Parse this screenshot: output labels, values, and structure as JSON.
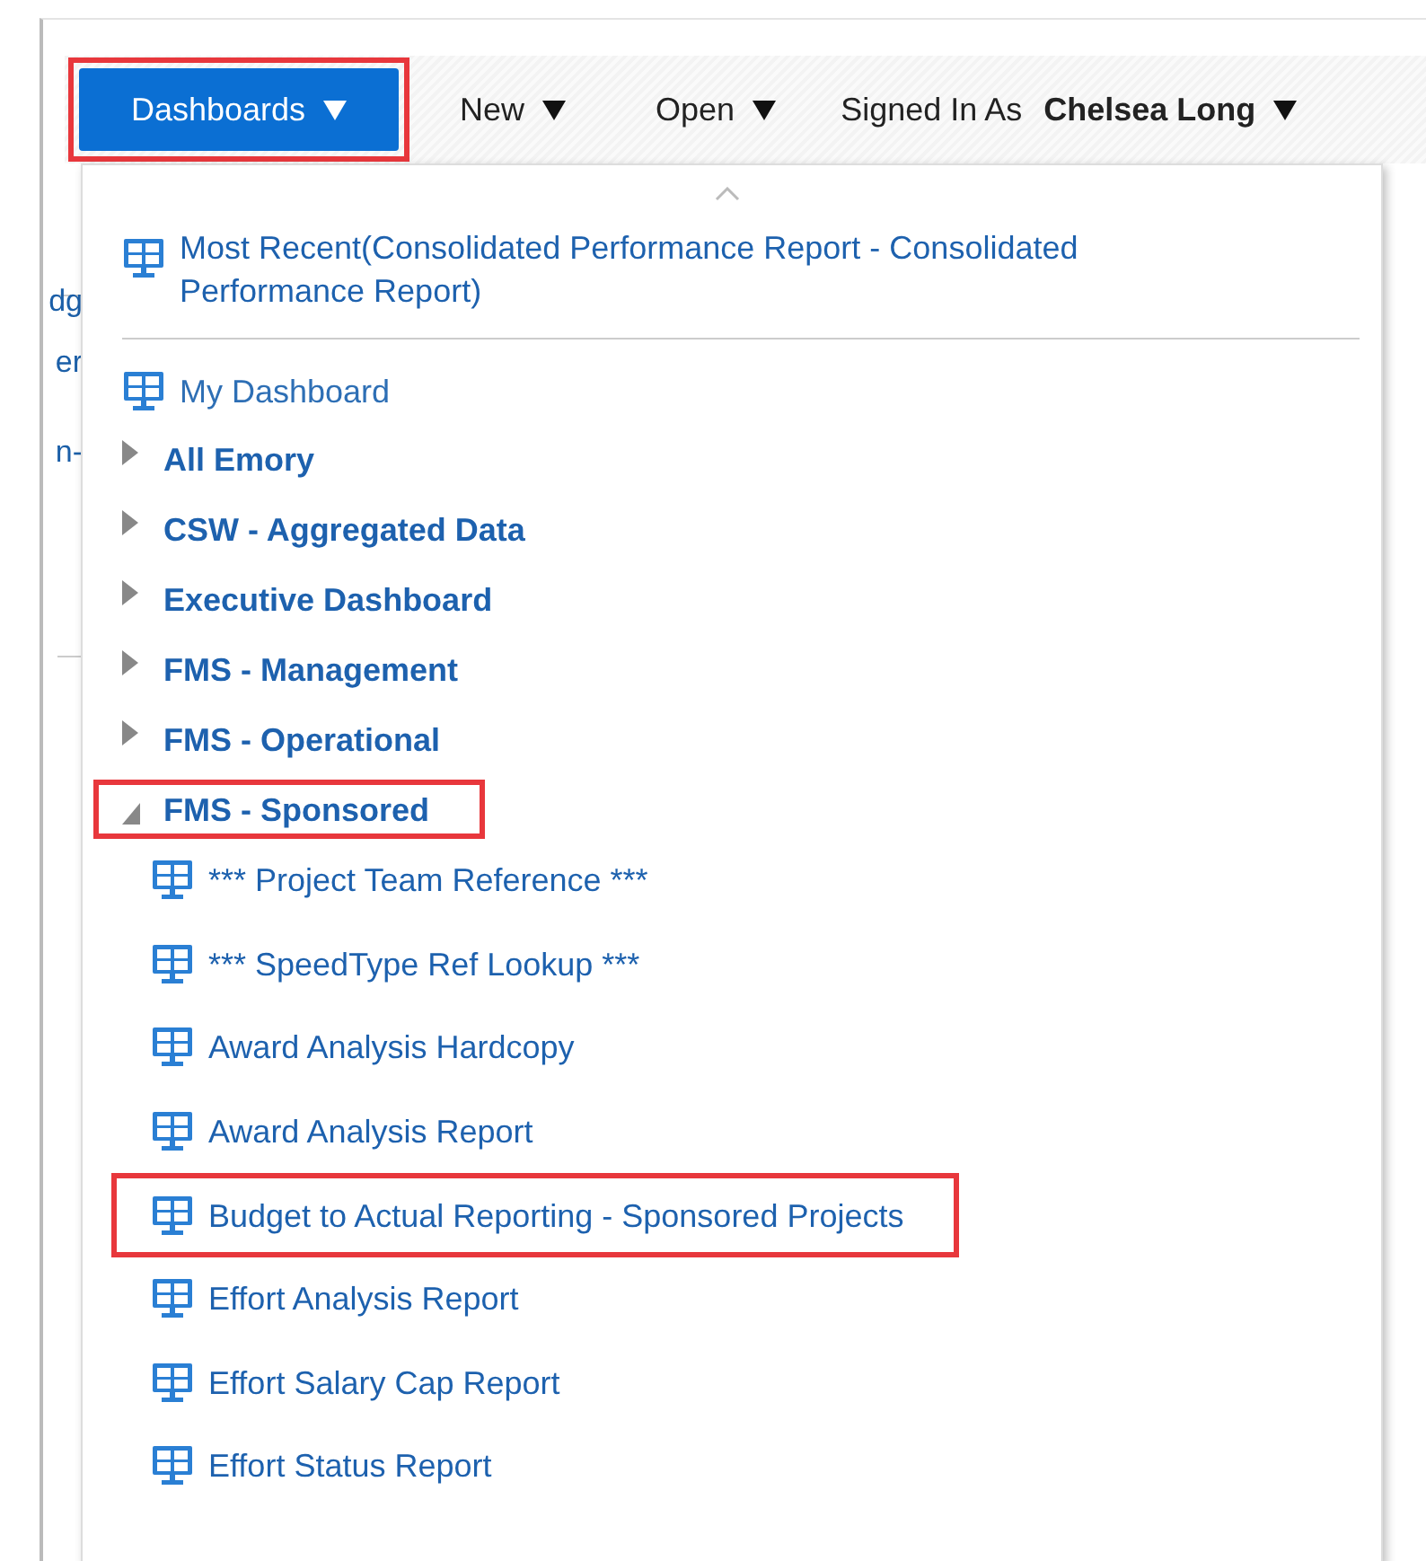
{
  "toolbar": {
    "items": [
      {
        "label": "Dashboards",
        "selected": true,
        "highlighted": true
      },
      {
        "label": "New",
        "selected": false,
        "highlighted": false
      },
      {
        "label": "Open",
        "selected": false,
        "highlighted": false
      }
    ],
    "signed_in_label": "Signed In As",
    "user": "Chelsea Long"
  },
  "background_fragments": [
    "dg",
    "er",
    "n-"
  ],
  "menu": {
    "most_recent": "Most Recent(Consolidated Performance Report - Consolidated Performance Report)",
    "my_dashboard": "My Dashboard",
    "folders": [
      {
        "label": "All Emory",
        "expanded": false,
        "highlighted": false
      },
      {
        "label": "CSW - Aggregated Data",
        "expanded": false,
        "highlighted": false
      },
      {
        "label": "Executive Dashboard",
        "expanded": false,
        "highlighted": false
      },
      {
        "label": "FMS - Management",
        "expanded": false,
        "highlighted": false
      },
      {
        "label": "FMS - Operational",
        "expanded": false,
        "highlighted": false
      },
      {
        "label": "FMS - Sponsored",
        "expanded": true,
        "highlighted": true,
        "children": [
          {
            "label": "*** Project Team Reference ***",
            "highlighted": false
          },
          {
            "label": "*** SpeedType Ref Lookup ***",
            "highlighted": false
          },
          {
            "label": "Award Analysis Hardcopy",
            "highlighted": false
          },
          {
            "label": "Award Analysis Report",
            "highlighted": false
          },
          {
            "label": "Budget to Actual Reporting - Sponsored Projects",
            "highlighted": true
          },
          {
            "label": "Effort Analysis Report",
            "highlighted": false
          },
          {
            "label": "Effort Salary Cap Report",
            "highlighted": false
          },
          {
            "label": "Effort Status Report",
            "highlighted": false
          }
        ]
      }
    ]
  }
}
